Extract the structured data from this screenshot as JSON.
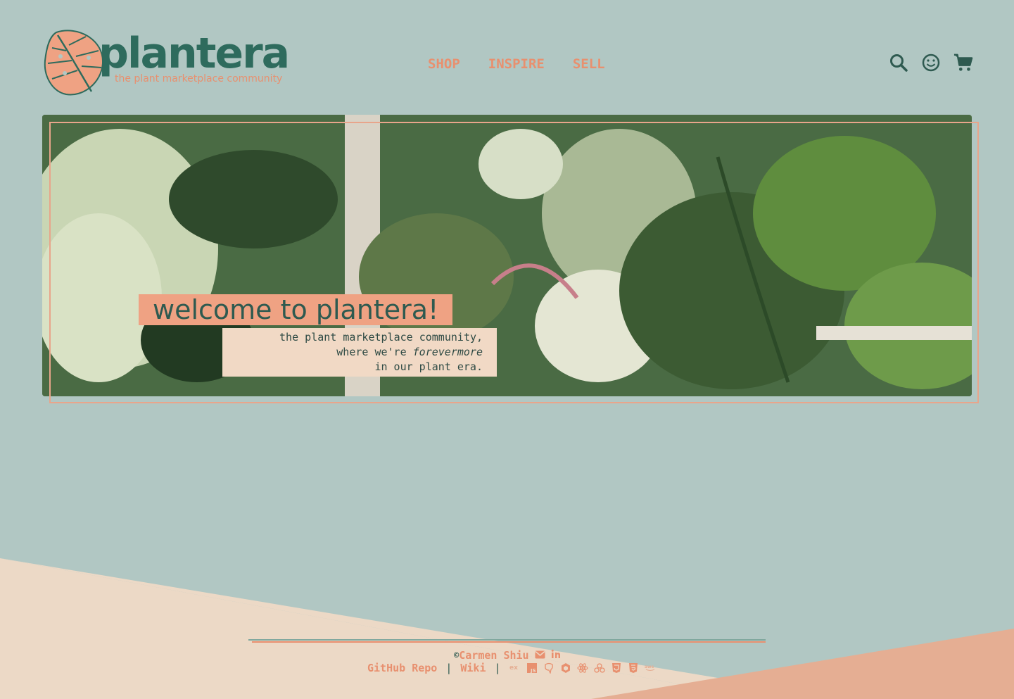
{
  "header": {
    "logo_word": "plantera",
    "logo_tagline": "the plant marketplace community",
    "nav": [
      {
        "label": "SHOP"
      },
      {
        "label": "INSPIRE"
      },
      {
        "label": "SELL"
      }
    ],
    "icons": [
      "search-icon",
      "user-smiley-icon",
      "cart-icon"
    ]
  },
  "hero": {
    "title": "welcome to plantera!",
    "subtitle_line1": "the plant marketplace community,",
    "subtitle_pre": "where we're ",
    "subtitle_em": "forevermore",
    "subtitle_post": " in our plant era."
  },
  "footer": {
    "copyright_symbol": "©",
    "author": "Carmen Shiu",
    "links": [
      {
        "label": "GitHub Repo"
      },
      {
        "label": "Wiki"
      }
    ],
    "separator": "|",
    "tech_icons": [
      "express-icon",
      "javascript-icon",
      "postgresql-icon",
      "sequelize-icon",
      "react-icon",
      "redux-icon",
      "html5-icon",
      "css3-icon",
      "aws-icon"
    ],
    "contact_icons": [
      "email-icon",
      "linkedin-icon"
    ]
  },
  "colors": {
    "background": "#b1c7c3",
    "accent_orange": "#e8906f",
    "dark_green": "#2e6b5d",
    "cream": "#ecd9c6",
    "salmon": "#e5ae93"
  }
}
